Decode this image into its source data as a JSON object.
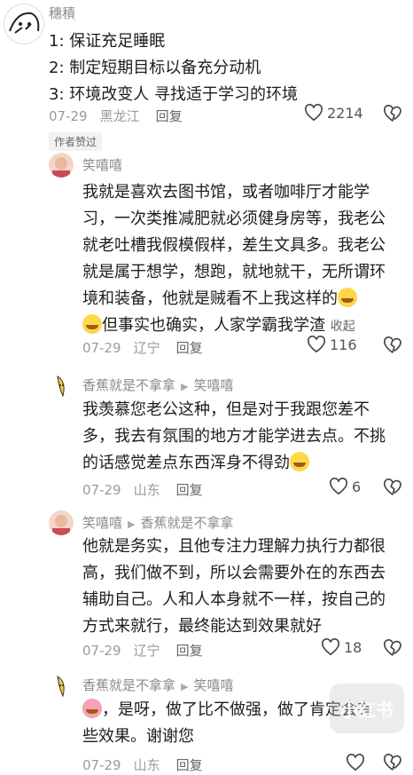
{
  "comment1": {
    "username": "穗積",
    "lines": [
      "1:  保证充足睡眠",
      "2:  制定短期目标以备充分动机",
      "3:  环境改变人  寻找适于学习的环境"
    ],
    "date": "07-29",
    "location": "黑龙江",
    "reply_label": "回复",
    "likes": "2214",
    "author_liked_badge": "作者赞过"
  },
  "reply1": {
    "username": "笑嘻嘻",
    "lines": [
      "我就是喜欢去图书馆，或者咖啡厅才能学",
      "习，一次类推减肥就必须健身房等，我老公",
      "就老吐槽我假模假样，差生文具多。我老公",
      "就是属于想学，想跑，就地就干，无所谓环",
      "境和装备，他就是贼看不上我这样的",
      "但事实也确实，人家学霸我学渣"
    ],
    "collapse_label": "收起",
    "date": "07-29",
    "location": "辽宁",
    "reply_label": "回复",
    "likes": "116"
  },
  "reply2": {
    "username": "香蕉就是不拿拿",
    "reply_to": "笑嘻嘻",
    "lines": [
      "我羡慕您老公这种，但是对于我跟您差不",
      "多，我去有氛围的地方才能学进去点。不挑",
      "的话感觉差点东西浑身不得劲"
    ],
    "date": "07-29",
    "location": "山东",
    "reply_label": "回复",
    "likes": "6"
  },
  "reply3": {
    "username": "笑嘻嘻",
    "reply_to": "香蕉就是不拿拿",
    "lines": [
      "他就是务实，且他专注力理解力执行力都很",
      "高，我们做不到，所以会需要外在的东西去",
      "辅助自己。人和人本身就不一样，按自己的",
      "方式来就行，最终能达到效果就好"
    ],
    "date": "07-29",
    "location": "辽宁",
    "reply_label": "回复",
    "likes": "18"
  },
  "reply4": {
    "username": "香蕉就是不拿拿",
    "reply_to": "笑嘻嘻",
    "lines": [
      "，是呀，做了比不做强，做了肯定会有",
      "些效果。谢谢您"
    ],
    "date": "07-29",
    "location": "山东",
    "reply_label": "回复"
  },
  "watermark": "小红书"
}
